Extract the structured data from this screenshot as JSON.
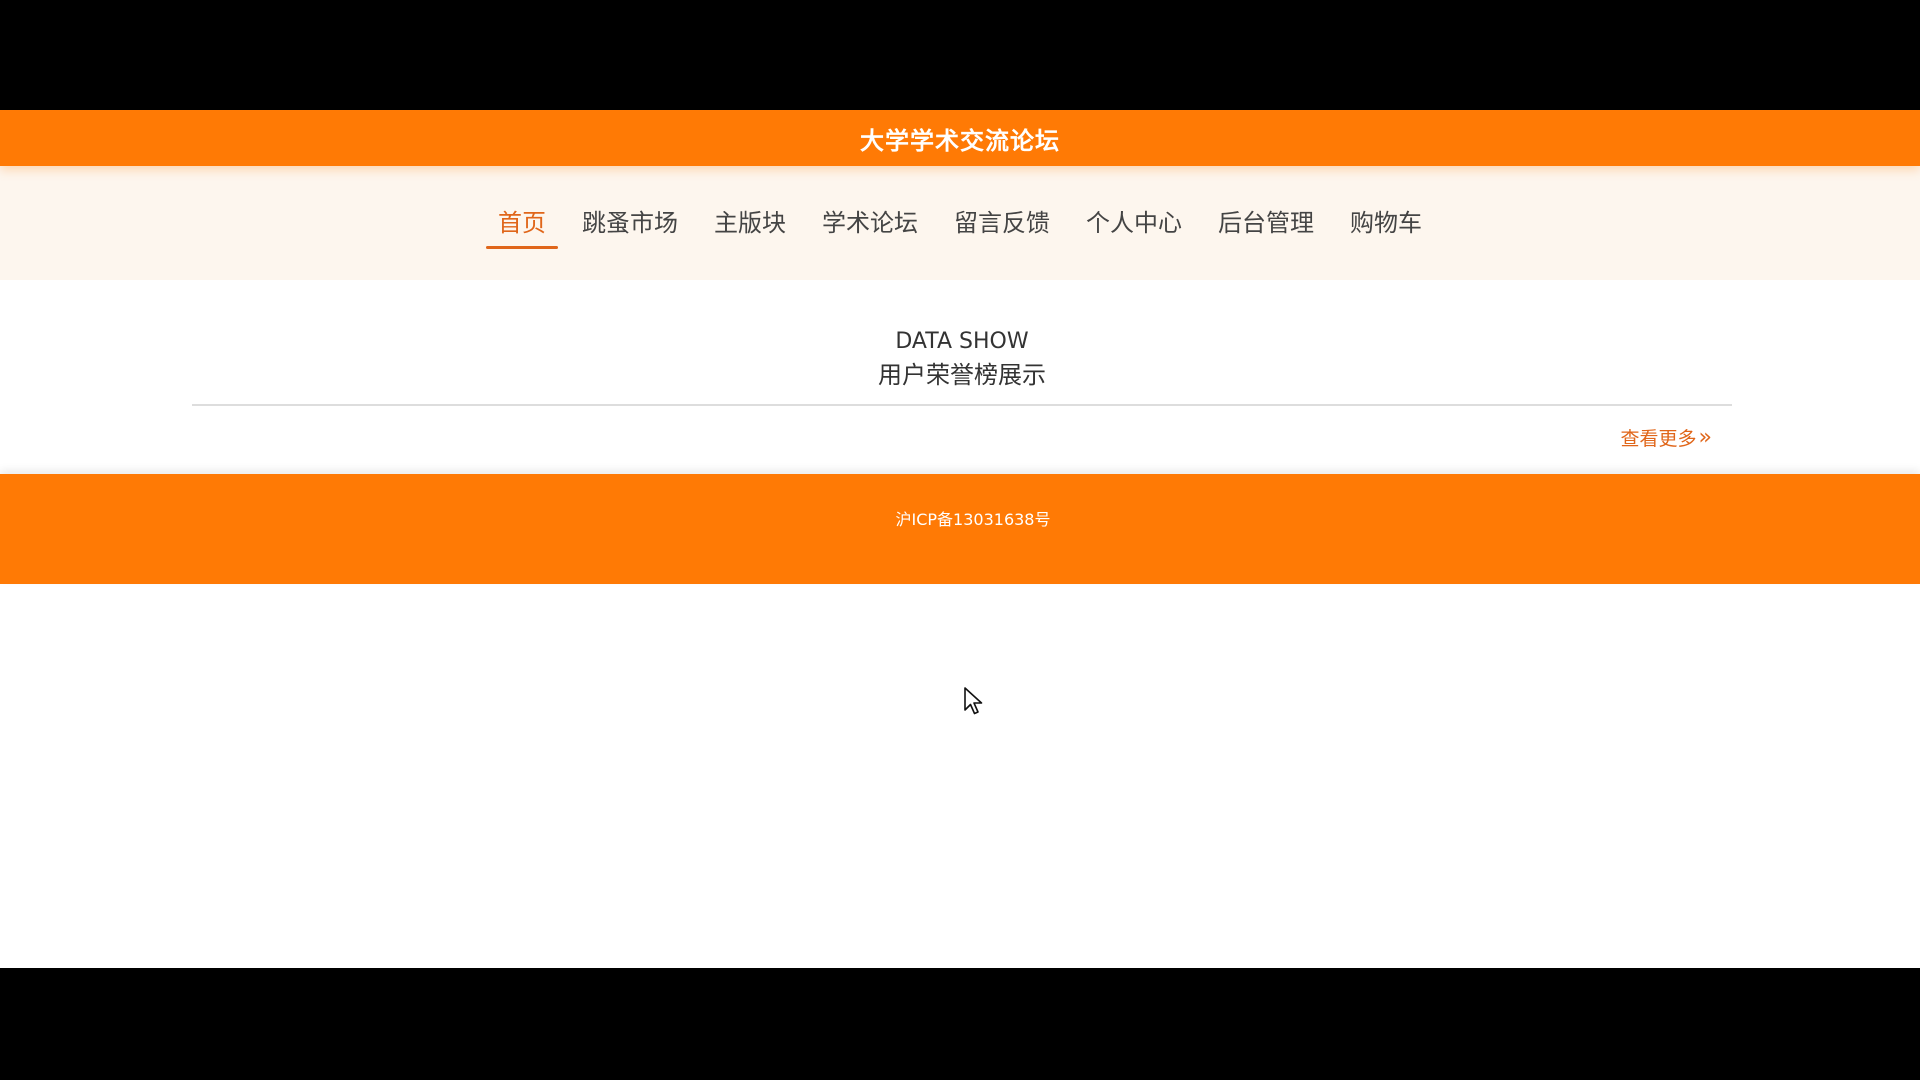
{
  "header": {
    "site_title": "大学学术交流论坛"
  },
  "nav": {
    "items": [
      {
        "label": "首页",
        "active": true
      },
      {
        "label": "跳蚤市场",
        "active": false
      },
      {
        "label": "主版块",
        "active": false
      },
      {
        "label": "学术论坛",
        "active": false
      },
      {
        "label": "留言反馈",
        "active": false
      },
      {
        "label": "个人中心",
        "active": false
      },
      {
        "label": "后台管理",
        "active": false
      },
      {
        "label": "购物车",
        "active": false
      }
    ]
  },
  "section": {
    "title_en": "DATA SHOW",
    "title_cn": "用户荣誉榜展示",
    "more_label": "查看更多"
  },
  "footer": {
    "icp": "沪ICP备13031638号"
  },
  "colors": {
    "brand": "#ff7a05",
    "accent": "#e0661a",
    "nav_bg": "#fdf6ee"
  },
  "icons": {
    "more": "double-chevron-right-icon",
    "cursor": "mouse-pointer-icon"
  }
}
